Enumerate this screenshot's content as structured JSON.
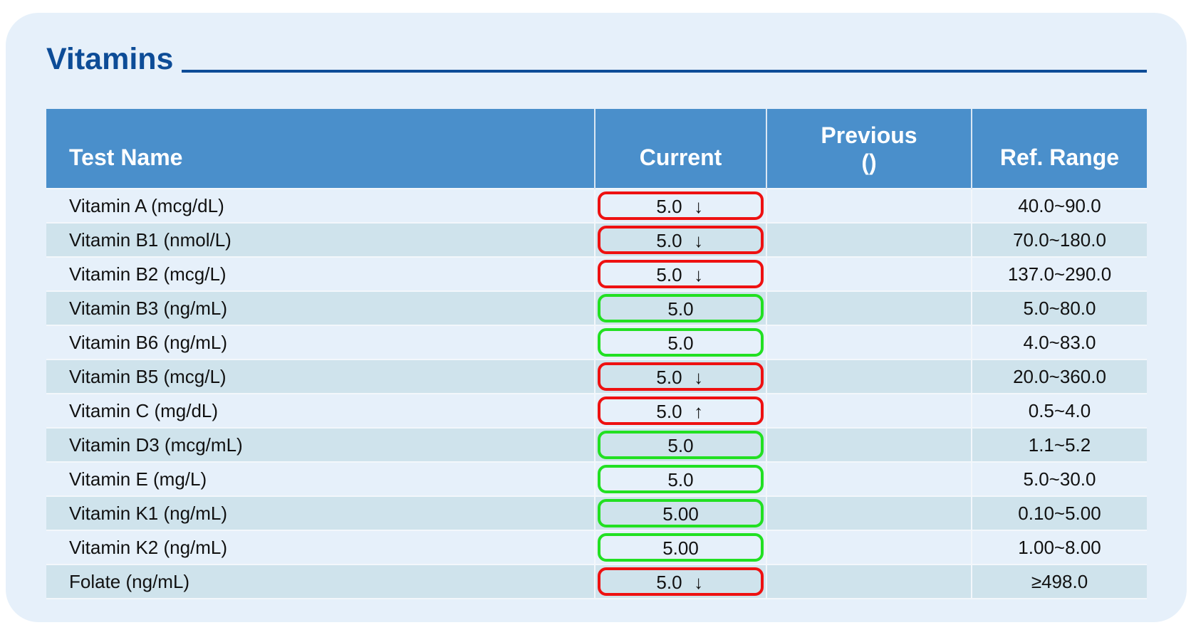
{
  "section": {
    "title": "Vitamins"
  },
  "table": {
    "headers": {
      "test_name": "Test Name",
      "current": "Current",
      "previous_line1": "Previous",
      "previous_line2": "()",
      "ref_range": "Ref. Range"
    },
    "rows": [
      {
        "name": "Vitamin A (mcg/dL)",
        "current": "5.0",
        "flag": "↓",
        "status": "abnormal",
        "previous": "",
        "ref": "40.0~90.0"
      },
      {
        "name": "Vitamin B1 (nmol/L)",
        "current": "5.0",
        "flag": "↓",
        "status": "abnormal",
        "previous": "",
        "ref": "70.0~180.0"
      },
      {
        "name": "Vitamin B2 (mcg/L)",
        "current": "5.0",
        "flag": "↓",
        "status": "abnormal",
        "previous": "",
        "ref": "137.0~290.0"
      },
      {
        "name": "Vitamin B3 (ng/mL)",
        "current": "5.0",
        "flag": "",
        "status": "normal",
        "previous": "",
        "ref": "5.0~80.0"
      },
      {
        "name": "Vitamin B6 (ng/mL)",
        "current": "5.0",
        "flag": "",
        "status": "normal",
        "previous": "",
        "ref": "4.0~83.0"
      },
      {
        "name": "Vitamin B5 (mcg/L)",
        "current": "5.0",
        "flag": "↓",
        "status": "abnormal",
        "previous": "",
        "ref": "20.0~360.0"
      },
      {
        "name": "Vitamin C (mg/dL)",
        "current": "5.0",
        "flag": "↑",
        "status": "abnormal",
        "previous": "",
        "ref": "0.5~4.0"
      },
      {
        "name": "Vitamin D3 (mcg/mL)",
        "current": "5.0",
        "flag": "",
        "status": "normal",
        "previous": "",
        "ref": "1.1~5.2"
      },
      {
        "name": "Vitamin E (mg/L)",
        "current": "5.0",
        "flag": "",
        "status": "normal",
        "previous": "",
        "ref": "5.0~30.0"
      },
      {
        "name": "Vitamin K1 (ng/mL)",
        "current": "5.00",
        "flag": "",
        "status": "normal",
        "previous": "",
        "ref": "0.10~5.00"
      },
      {
        "name": "Vitamin K2 (ng/mL)",
        "current": "5.00",
        "flag": "",
        "status": "normal",
        "previous": "",
        "ref": "1.00~8.00"
      },
      {
        "name": "Folate (ng/mL)",
        "current": "5.0",
        "flag": "↓",
        "status": "abnormal",
        "previous": "",
        "ref": "≥498.0"
      }
    ]
  },
  "colors": {
    "title": "#0d4c97",
    "header_bg": "#4a8fcb",
    "card_bg": "#e6f0fa",
    "row_alt_bg": "#cfe3ec",
    "abnormal_outline": "#ee1111",
    "normal_outline": "#22e022"
  }
}
